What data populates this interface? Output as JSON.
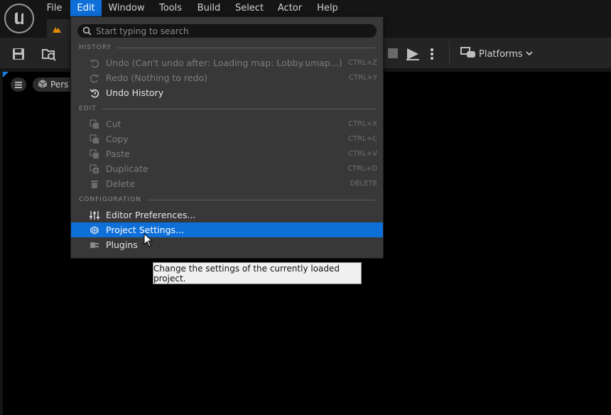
{
  "menubar": {
    "items": [
      {
        "label": "File",
        "active": false
      },
      {
        "label": "Edit",
        "active": true
      },
      {
        "label": "Window",
        "active": false
      },
      {
        "label": "Tools",
        "active": false
      },
      {
        "label": "Build",
        "active": false
      },
      {
        "label": "Select",
        "active": false
      },
      {
        "label": "Actor",
        "active": false
      },
      {
        "label": "Help",
        "active": false
      }
    ]
  },
  "toolbar": {
    "platforms_label": "Platforms"
  },
  "viewport": {
    "perspective_label": "Pers"
  },
  "edit_menu": {
    "search": {
      "placeholder": "Start typing to search"
    },
    "sections": {
      "history": "HISTORY",
      "edit": "EDIT",
      "configuration": "CONFIGURATION"
    },
    "history_items": [
      {
        "label": "Undo (Can't undo after: Loading map: Lobby.umap...)",
        "shortcut": "CTRL+Z",
        "icon": "undo-icon",
        "enabled": false
      },
      {
        "label": "Redo (Nothing to redo)",
        "shortcut": "CTRL+Y",
        "icon": "redo-icon",
        "enabled": false
      },
      {
        "label": "Undo History",
        "shortcut": "",
        "icon": "undo-history-icon",
        "enabled": true
      }
    ],
    "edit_items": [
      {
        "label": "Cut",
        "shortcut": "CTRL+X",
        "icon": "cut-icon",
        "enabled": false
      },
      {
        "label": "Copy",
        "shortcut": "CTRL+C",
        "icon": "copy-icon",
        "enabled": false
      },
      {
        "label": "Paste",
        "shortcut": "CTRL+V",
        "icon": "paste-icon",
        "enabled": false
      },
      {
        "label": "Duplicate",
        "shortcut": "CTRL+D",
        "icon": "duplicate-icon",
        "enabled": false
      },
      {
        "label": "Delete",
        "shortcut": "DELETE",
        "icon": "trash-icon",
        "enabled": false
      }
    ],
    "configuration_items": [
      {
        "label": "Editor Preferences...",
        "icon": "sliders-icon",
        "highlighted": false
      },
      {
        "label": "Project Settings...",
        "icon": "project-settings-icon",
        "highlighted": true
      },
      {
        "label": "Plugins",
        "icon": "plugin-icon",
        "highlighted": false
      }
    ]
  },
  "tooltip": {
    "text": "Change the settings of the currently loaded project."
  },
  "colors": {
    "accent": "#0e6fd8",
    "menu_bg": "#383838",
    "background": "#151515",
    "viewport": "#000000"
  }
}
